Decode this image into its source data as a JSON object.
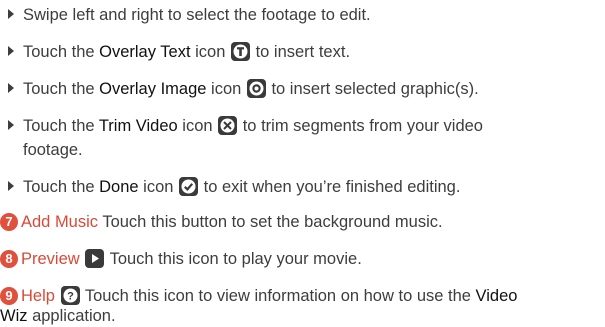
{
  "bullets": [
    {
      "pre": "Swipe left and right to select the footage to edit.",
      "term": "",
      "post": ""
    },
    {
      "pre": "Touch the ",
      "term": "Overlay Text",
      "mid": " icon ",
      "post": " to insert text."
    },
    {
      "pre": "Touch the ",
      "term": "Overlay Image",
      "mid": " icon ",
      "post": " to insert selected graphic(s)."
    },
    {
      "pre": "Touch the ",
      "term": "Trim Video",
      "mid": " icon ",
      "post": " to trim segments from your video",
      "post2": "footage."
    },
    {
      "pre": "Touch the ",
      "term": "Done",
      "mid": " icon ",
      "post": " to exit when you’re finished editing."
    }
  ],
  "items": [
    {
      "num": "7",
      "title": "Add Music",
      "text": " Touch this button to set the background music."
    },
    {
      "num": "8",
      "title": "Preview",
      "text": " Touch this icon to play your movie."
    },
    {
      "num": "9",
      "title": "Help",
      "text": " Touch this icon to view information on how to use the ",
      "term": "Video",
      "line2": "Wiz",
      "line2b": " application."
    }
  ],
  "icons": [
    "overlay-text-icon",
    "overlay-image-icon",
    "trim-video-icon",
    "done-icon",
    "preview-icon",
    "help-icon"
  ]
}
